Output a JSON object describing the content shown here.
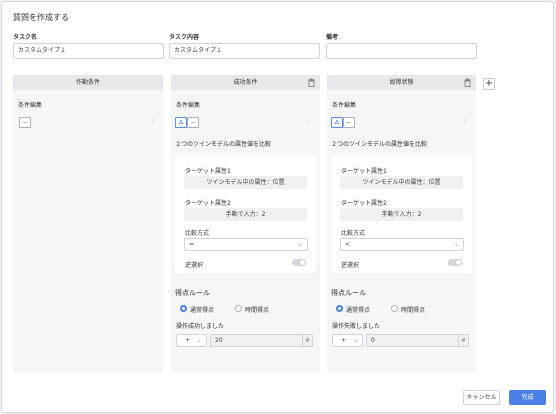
{
  "dialog": {
    "title": "質問を作成する",
    "task_name_label": "タスク名",
    "task_name_value": "カスタムタイプ１",
    "task_content_label": "タスク内容",
    "task_content_value": "カスタムタイプ１",
    "note_label": "備考",
    "note_value": "",
    "cancel_label": "キャンセル",
    "ok_label": "完成"
  },
  "panels": {
    "trigger": {
      "title": "作動条件",
      "condition_edit_label": "条件編集",
      "icon_symbol": "−"
    },
    "success": {
      "title": "成功条件",
      "condition_edit_label": "条件編集",
      "icon_symbol": "∆",
      "icon_symbol2": "−",
      "description": "２つのツインモデルの属性値を比較",
      "target1_label": "ターゲット属性1",
      "target1_value": "ツインモデル中の属性：位置",
      "target2_label": "ターゲット属性2",
      "target2_value": "手動で入力：2",
      "compare_label": "比較方式",
      "compare_value": "=",
      "reverse_label": "逆選択",
      "score_rule_label": "得点ルール",
      "radio_normal": "通常得点",
      "radio_time": "時間得点",
      "op_label": "操作成功しました",
      "stepper_value": "+",
      "number_value": "20"
    },
    "failure": {
      "title": "故障状態",
      "condition_edit_label": "条件編集",
      "icon_symbol": "∆",
      "icon_symbol2": "−",
      "description": "２つのツインモデルの属性値を比較",
      "target1_label": "ターゲット属性1",
      "target1_value": "ツインモデル中の属性：位置",
      "target2_label": "ターゲット属性2",
      "target2_value": "手動で入力：2",
      "compare_label": "比較方式",
      "compare_value": "<",
      "reverse_label": "逆選択",
      "score_rule_label": "得点ルール",
      "radio_normal": "通常得点",
      "radio_time": "時間得点",
      "op_label": "操作失敗しました",
      "stepper_value": "+",
      "number_value": "0"
    }
  },
  "icons": {
    "trash": "trash-icon",
    "add": "plus-icon",
    "dropdown": "chevron-down-icon",
    "more": "more-vertical-icon",
    "number": "calculator-icon"
  },
  "colors": {
    "accent": "#4a7fe6",
    "panel_bg": "#f5f6f8",
    "panel_header": "#e6e8eb"
  },
  "state": {
    "success_reverse_on": false,
    "failure_reverse_on": false,
    "success_score_rule": "通常得点",
    "failure_score_rule": "通常得点"
  }
}
